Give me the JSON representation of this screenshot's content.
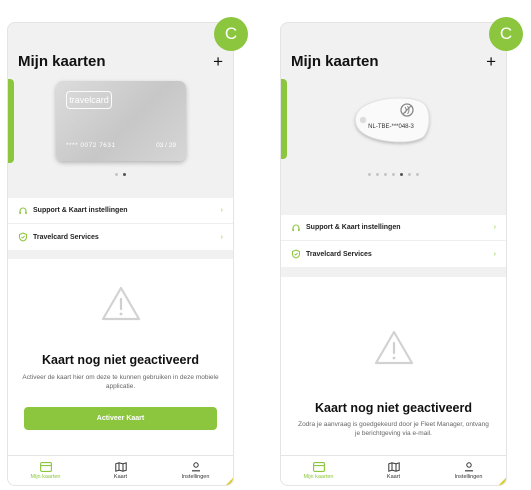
{
  "colors": {
    "accent": "#8cc63f",
    "card": "#cccccc",
    "corner": "#d9cf34"
  },
  "screens": [
    {
      "badge": "C",
      "title": "Mijn kaarten",
      "add_label": "+",
      "card": {
        "brand": "travelcard",
        "number": "**** 0072 7631",
        "expiry": "03 / 29"
      },
      "carousel": {
        "count": 2,
        "active": 1
      },
      "menu": [
        {
          "label": "Support & Kaart instellingen",
          "icon": "headset-icon",
          "chevron": "›"
        },
        {
          "label": "Travelcard Services",
          "icon": "shield-icon",
          "chevron": "›"
        }
      ],
      "status": {
        "title": "Kaart nog niet geactiveerd",
        "description": "Activeer de kaart hier om deze te kunnen gebruiken in deze mobiele applicatie.",
        "button": "Activeer Kaart"
      },
      "tabs": [
        {
          "label": "Mijn kaarten",
          "icon": "card-icon",
          "active": true
        },
        {
          "label": "Kaart",
          "icon": "map-icon",
          "active": false
        },
        {
          "label": "Instellingen",
          "icon": "user-icon",
          "active": false
        }
      ]
    },
    {
      "badge": "C",
      "title": "Mijn kaarten",
      "add_label": "+",
      "tag": {
        "code": "NL-TBE-***048-3"
      },
      "carousel": {
        "count": 7,
        "active": 4
      },
      "menu": [
        {
          "label": "Support & Kaart instellingen",
          "icon": "headset-icon",
          "chevron": "›"
        },
        {
          "label": "Travelcard Services",
          "icon": "shield-icon",
          "chevron": "›"
        }
      ],
      "status": {
        "title": "Kaart nog niet geactiveerd",
        "description": "Zodra je aanvraag is goedgekeurd door je Fleet Manager, ontvang je berichtgeving via e-mail."
      },
      "tabs": [
        {
          "label": "Mijn kaarten",
          "icon": "card-icon",
          "active": true
        },
        {
          "label": "Kaart",
          "icon": "map-icon",
          "active": false
        },
        {
          "label": "Instellingen",
          "icon": "user-icon",
          "active": false
        }
      ]
    }
  ]
}
